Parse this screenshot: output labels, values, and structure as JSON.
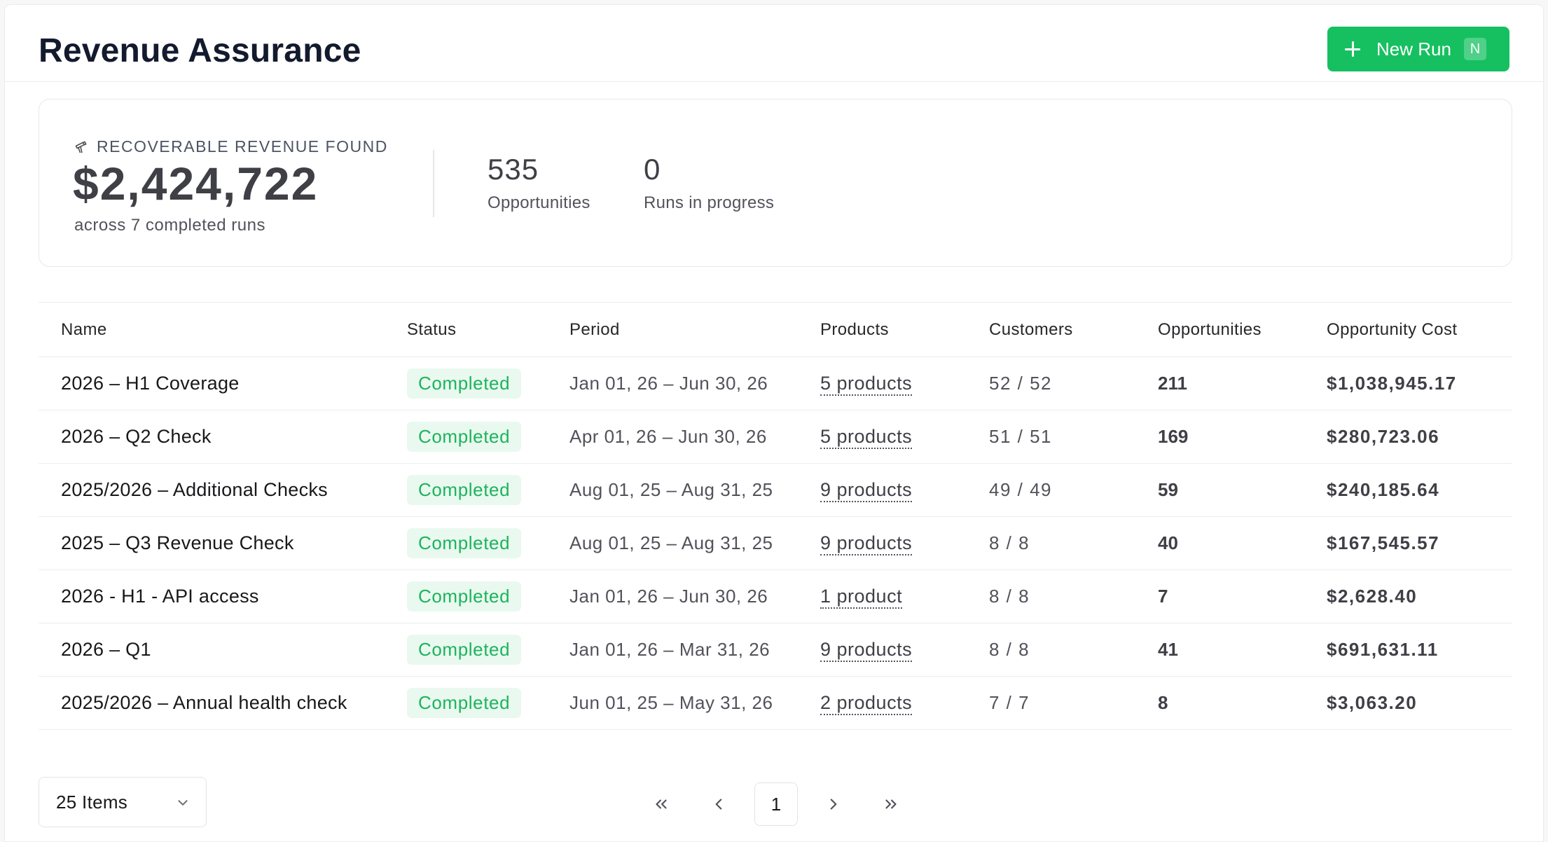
{
  "header": {
    "title": "Revenue Assurance",
    "new_run_label": "New Run",
    "new_run_shortcut": "N"
  },
  "summary": {
    "kicker": "RECOVERABLE REVENUE FOUND",
    "total": "$2,424,722",
    "subtitle": "across 7 completed runs",
    "stats": [
      {
        "value": "535",
        "label": "Opportunities"
      },
      {
        "value": "0",
        "label": "Runs in progress"
      }
    ]
  },
  "table": {
    "columns": [
      "Name",
      "Status",
      "Period",
      "Products",
      "Customers",
      "Opportunities",
      "Opportunity Cost"
    ],
    "rows": [
      {
        "name": "2026 – H1 Coverage",
        "status": "Completed",
        "period": "Jan 01, 26 – Jun 30, 26",
        "products": "5 products",
        "customers": "52 / 52",
        "opportunities": "211",
        "cost": "$1,038,945.17"
      },
      {
        "name": "2026 – Q2 Check",
        "status": "Completed",
        "period": "Apr 01, 26 – Jun 30, 26",
        "products": "5 products",
        "customers": "51 / 51",
        "opportunities": "169",
        "cost": "$280,723.06"
      },
      {
        "name": "2025/2026 – Additional Checks",
        "status": "Completed",
        "period": "Aug 01, 25 – Aug 31, 25",
        "products": "9 products",
        "customers": "49 / 49",
        "opportunities": "59",
        "cost": "$240,185.64"
      },
      {
        "name": "2025 – Q3 Revenue Check",
        "status": "Completed",
        "period": "Aug 01, 25 – Aug 31, 25",
        "products": "9 products",
        "customers": "8 / 8",
        "opportunities": "40",
        "cost": "$167,545.57"
      },
      {
        "name": "2026 - H1 - API access",
        "status": "Completed",
        "period": "Jan 01, 26 – Jun 30, 26",
        "products": "1 product",
        "customers": "8 / 8",
        "opportunities": "7",
        "cost": "$2,628.40"
      },
      {
        "name": "2026 – Q1",
        "status": "Completed",
        "period": "Jan 01, 26 – Mar 31, 26",
        "products": "9 products",
        "customers": "8 / 8",
        "opportunities": "41",
        "cost": "$691,631.11"
      },
      {
        "name": "2025/2026 – Annual health check",
        "status": "Completed",
        "period": "Jun 01, 25 – May 31, 26",
        "products": "2 products",
        "customers": "7 / 7",
        "opportunities": "8",
        "cost": "$3,063.20"
      }
    ]
  },
  "pagination": {
    "page_size": "25 Items",
    "current_page": "1"
  },
  "colors": {
    "accent": "#16c060",
    "status_bg": "#e9f9ef",
    "status_text": "#1db35c"
  },
  "icons": {
    "kicker": "telescope-icon",
    "page_size": "chevron-down-icon",
    "first": "chevrons-left-icon",
    "prev": "chevron-left-icon",
    "next": "chevron-right-icon",
    "last": "chevrons-right-icon"
  }
}
